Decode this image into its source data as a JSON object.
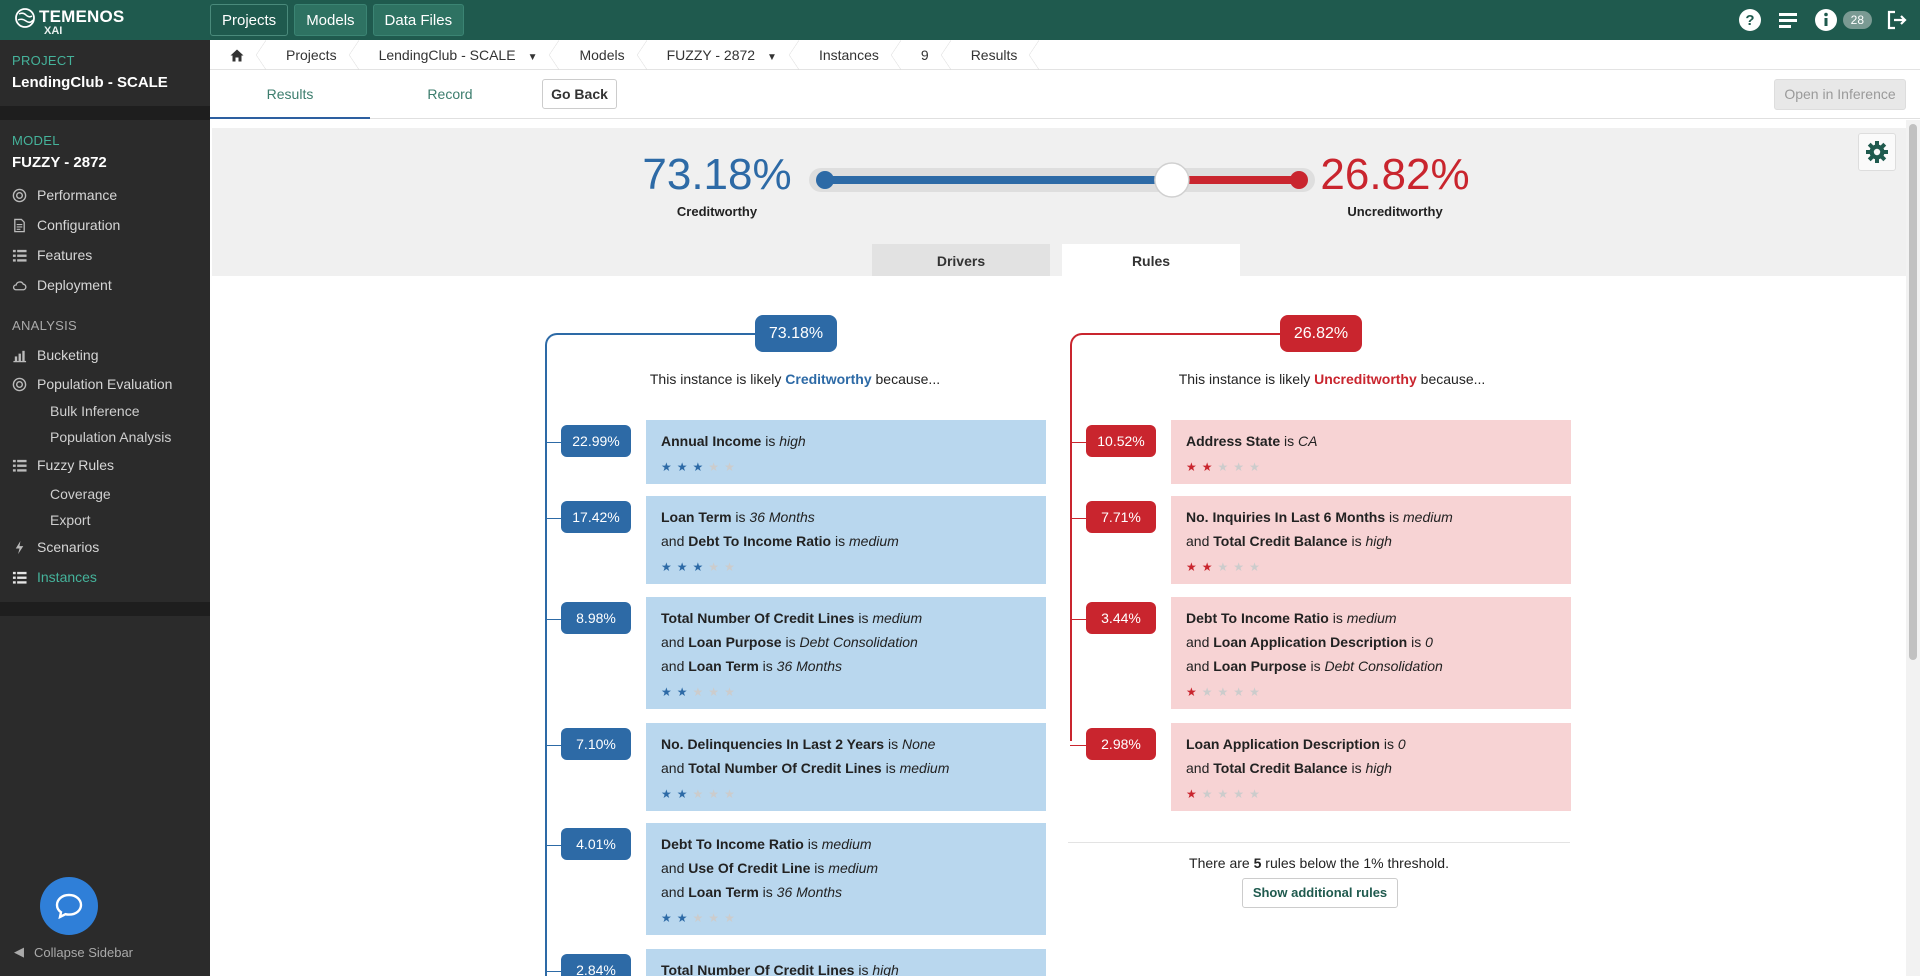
{
  "brand": {
    "name": "TEMENOS",
    "sub": "XAI"
  },
  "topnav": [
    {
      "label": "Projects"
    },
    {
      "label": "Models"
    },
    {
      "label": "Data Files"
    }
  ],
  "topbar": {
    "badge_count": "28"
  },
  "sidebar": {
    "project_label": "PROJECT",
    "project_name": "LendingClub - SCALE",
    "model_label": "MODEL",
    "model_name": "FUZZY - 2872",
    "model_items": [
      {
        "label": "Performance",
        "icon": "target-icon"
      },
      {
        "label": "Configuration",
        "icon": "document-icon"
      },
      {
        "label": "Features",
        "icon": "list-icon"
      },
      {
        "label": "Deployment",
        "icon": "cloud-icon"
      }
    ],
    "analysis_label": "ANALYSIS",
    "analysis_items": {
      "bucketing": "Bucketing",
      "population_evaluation": "Population Evaluation",
      "bulk_inference": "Bulk Inference",
      "population_analysis": "Population Analysis",
      "fuzzy_rules": "Fuzzy Rules",
      "coverage": "Coverage",
      "export": "Export",
      "scenarios": "Scenarios",
      "instances": "Instances"
    },
    "collapse_label": "Collapse Sidebar"
  },
  "breadcrumb": {
    "projects": "Projects",
    "project": "LendingClub - SCALE",
    "models": "Models",
    "model": "FUZZY - 2872",
    "instances": "Instances",
    "instance_id": "9",
    "results": "Results"
  },
  "tabs": {
    "results": "Results",
    "record": "Record",
    "go_back": "Go Back",
    "open_inference": "Open in Inference"
  },
  "gauge": {
    "creditworthy_pct": "73.18%",
    "creditworthy_label": "Creditworthy",
    "uncreditworthy_pct": "26.82%",
    "uncreditworthy_label": "Uncreditworthy",
    "creditworthy_fraction": 0.7318
  },
  "detail_tabs": {
    "drivers": "Drivers",
    "rules": "Rules"
  },
  "left": {
    "badge": "73.18%",
    "prefix": "This instance is likely ",
    "outcome": "Creditworthy",
    "suffix": " because...",
    "rules": [
      {
        "pct": "22.99%",
        "stars": 3,
        "lines": [
          {
            "and": "",
            "feature": "Annual Income",
            "value": "high"
          }
        ]
      },
      {
        "pct": "17.42%",
        "stars": 3,
        "lines": [
          {
            "and": "",
            "feature": "Loan Term",
            "value": "36 Months"
          },
          {
            "and": "and ",
            "feature": "Debt To Income Ratio",
            "value": "medium"
          }
        ]
      },
      {
        "pct": "8.98%",
        "stars": 2,
        "lines": [
          {
            "and": "",
            "feature": "Total Number Of Credit Lines",
            "value": "medium"
          },
          {
            "and": "and ",
            "feature": "Loan Purpose",
            "value": "Debt Consolidation"
          },
          {
            "and": "and ",
            "feature": "Loan Term",
            "value": "36 Months"
          }
        ]
      },
      {
        "pct": "7.10%",
        "stars": 2,
        "lines": [
          {
            "and": "",
            "feature": "No. Delinquencies In Last 2 Years",
            "value": "None"
          },
          {
            "and": "and ",
            "feature": "Total Number Of Credit Lines",
            "value": "medium"
          }
        ]
      },
      {
        "pct": "4.01%",
        "stars": 2,
        "lines": [
          {
            "and": "",
            "feature": "Debt To Income Ratio",
            "value": "medium"
          },
          {
            "and": "and ",
            "feature": "Use Of Credit Line",
            "value": "medium"
          },
          {
            "and": "and ",
            "feature": "Loan Term",
            "value": "36 Months"
          }
        ]
      },
      {
        "pct": "2.84%",
        "stars": 0,
        "lines": [
          {
            "and": "",
            "feature": "Total Number Of Credit Lines",
            "value": "high"
          }
        ]
      }
    ]
  },
  "right": {
    "badge": "26.82%",
    "prefix": "This instance is likely ",
    "outcome": "Uncreditworthy",
    "suffix": " because...",
    "rules": [
      {
        "pct": "10.52%",
        "stars": 2,
        "lines": [
          {
            "and": "",
            "feature": "Address State",
            "value": "CA"
          }
        ]
      },
      {
        "pct": "7.71%",
        "stars": 2,
        "lines": [
          {
            "and": "",
            "feature": "No. Inquiries In Last 6 Months",
            "value": "medium"
          },
          {
            "and": "and ",
            "feature": "Total Credit Balance",
            "value": "high"
          }
        ]
      },
      {
        "pct": "3.44%",
        "stars": 1,
        "lines": [
          {
            "and": "",
            "feature": "Debt To Income Ratio",
            "value": "medium"
          },
          {
            "and": "and ",
            "feature": "Loan Application Description",
            "value": "0"
          },
          {
            "and": "and ",
            "feature": "Loan Purpose",
            "value": "Debt Consolidation"
          }
        ]
      },
      {
        "pct": "2.98%",
        "stars": 1,
        "lines": [
          {
            "and": "",
            "feature": "Loan Application Description",
            "value": "0"
          },
          {
            "and": "and ",
            "feature": "Total Credit Balance",
            "value": "high"
          }
        ]
      }
    ],
    "threshold_prefix": "There are ",
    "threshold_count": "5",
    "threshold_suffix": " rules below the 1% threshold.",
    "show_more": "Show additional rules"
  },
  "colors": {
    "creditworthy": "#2d6aa6",
    "uncreditworthy": "#c9252e",
    "brand": "#1f5a4e",
    "accent": "#45b39b"
  }
}
